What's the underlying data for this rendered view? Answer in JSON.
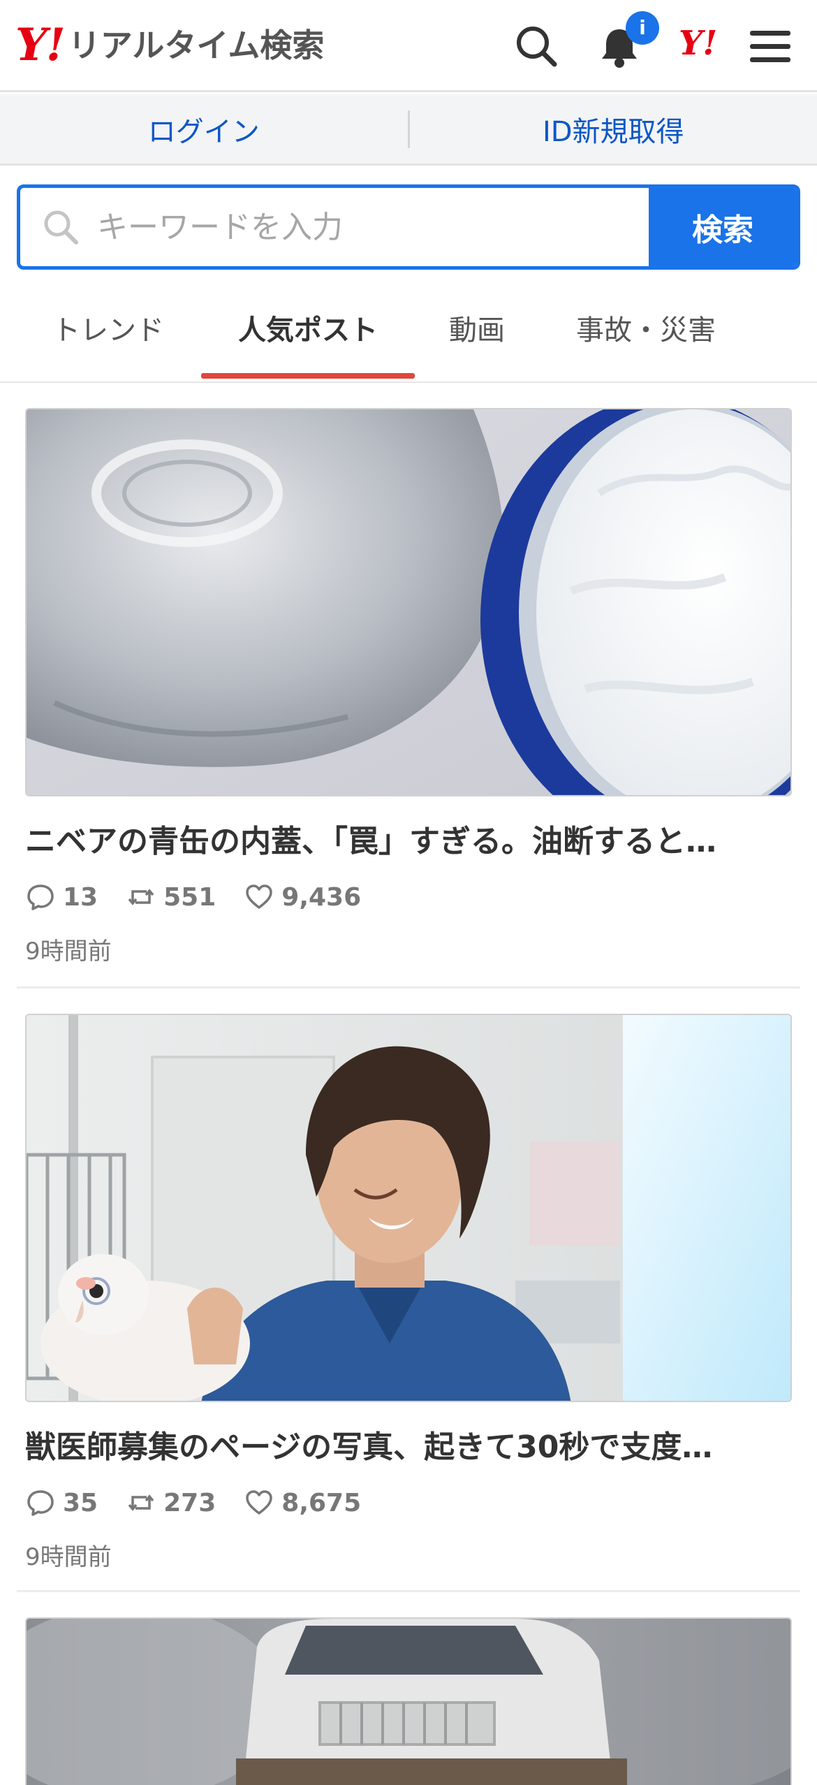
{
  "header": {
    "logo_y": "Y!",
    "logo_text": "リアルタイム検索",
    "badge": "i",
    "yahoo_small": "Y!"
  },
  "loginbar": {
    "login": "ログイン",
    "register": "ID新規取得"
  },
  "search": {
    "placeholder": "キーワードを入力",
    "button": "検索"
  },
  "tabs": [
    "トレンド",
    "人気ポスト",
    "動画",
    "事故・災害"
  ],
  "posts": [
    {
      "title": "ニベアの青缶の内蓋、「罠」すぎる。油断すると…",
      "replies": "13",
      "reposts": "551",
      "likes": "9,436",
      "time": "9時間前"
    },
    {
      "title": "獣医師募集のページの写真、起きて30秒で支度…",
      "replies": "35",
      "reposts": "273",
      "likes": "8,675",
      "time": "9時間前"
    }
  ],
  "colors": {
    "accent": "#1a73e8",
    "brand": "#e60012",
    "tab_underline": "#e0473e"
  }
}
